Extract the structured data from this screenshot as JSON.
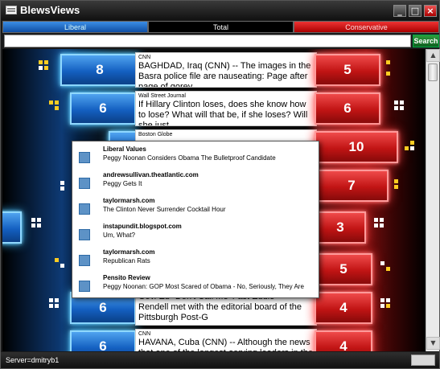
{
  "window": {
    "title": "BlewsViews"
  },
  "tabs": {
    "liberal": "Liberal",
    "total": "Total",
    "conservative": "Conservative"
  },
  "search": {
    "value": "",
    "button": "Search"
  },
  "rows": [
    {
      "lib": "8",
      "con": "5",
      "source": "CNN",
      "headline": "BAGHDAD, Iraq (CNN)  -- The images in the Basra police file are nauseating: Page after page of gorey"
    },
    {
      "lib": "6",
      "con": "6",
      "source": "Wall Street Journal",
      "headline": "If Hillary Clinton loses, does she know how to lose? What will that be, if she loses? Will she just"
    },
    {
      "lib": "",
      "con": "10",
      "source": "Boston Globe",
      "headline": ""
    },
    {
      "lib": "",
      "con": "7",
      "source": "",
      "headline": ""
    },
    {
      "lib": "",
      "con": "3",
      "source": "",
      "headline": ""
    },
    {
      "lib": "",
      "con": "5",
      "source": "",
      "headline": ""
    },
    {
      "lib": "6",
      "con": "4",
      "source": "",
      "headline": "Gov. Ed \"Don't Call Me 'Fast Eddie' \" Rendell met with the editorial board of the Pittsburgh Post-G"
    },
    {
      "lib": "6",
      "con": "4",
      "source": "CNN",
      "headline": "HAVANA, Cuba (CNN)  -- Although the news that one of the longest-serving leaders in the"
    }
  ],
  "popup": [
    {
      "source": "Liberal Values",
      "title": "Peggy Noonan Considers Obama The Bulletproof Candidate"
    },
    {
      "source": "andrewsullivan.theatlantic.com",
      "title": "Peggy Gets It"
    },
    {
      "source": "taylormarsh.com",
      "title": "The Clinton Never Surrender Cocktail Hour"
    },
    {
      "source": "instapundit.blogspot.com",
      "title": "Um, What?"
    },
    {
      "source": "taylormarsh.com",
      "title": "Republican Rats"
    },
    {
      "source": "Pensito Review",
      "title": "Peggy Noonan: GOP Most Scared of Obama - No, Seriously, They Are"
    }
  ],
  "status": {
    "server": "Server=dmitryb1"
  }
}
